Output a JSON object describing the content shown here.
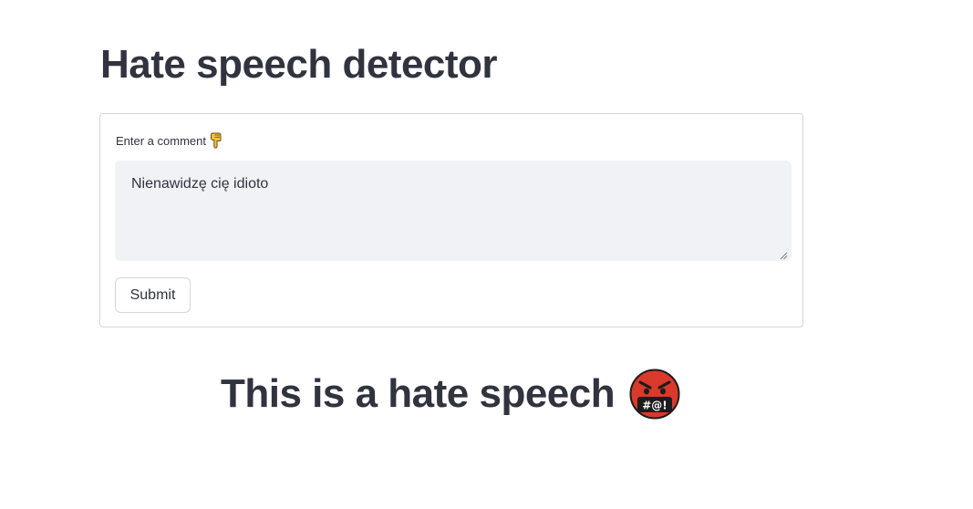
{
  "page": {
    "title": "Hate speech detector"
  },
  "form": {
    "label": "Enter a comment",
    "label_icon": "backhand-index-pointing-down-icon",
    "textarea_value": "Nienawidzę cię idioto",
    "submit_label": "Submit"
  },
  "result": {
    "text": "This is a hate speech",
    "icon": "face-with-symbols-on-mouth-icon"
  },
  "colors": {
    "text": "#31333f",
    "input_bg": "#f0f2f6",
    "border": "#d6d6d9",
    "emoji_red": "#d93a2b"
  }
}
